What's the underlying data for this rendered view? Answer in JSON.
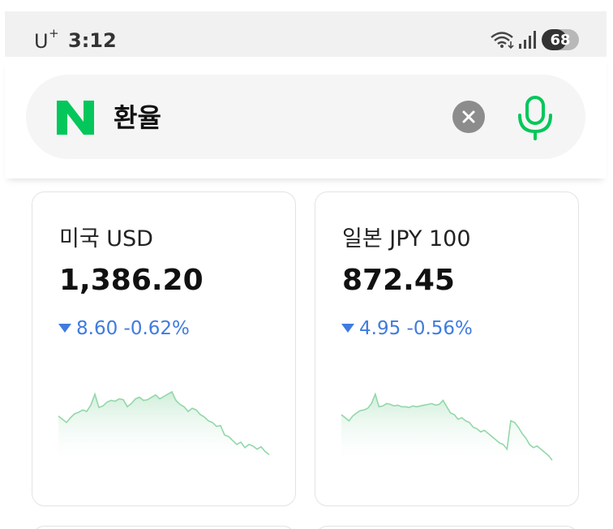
{
  "status_bar": {
    "carrier": "U",
    "carrier_mark": "+",
    "time": "3:12",
    "battery": "68",
    "battery_level": 0.68
  },
  "search": {
    "logo": "N",
    "query": "환율",
    "clear_icon": "close-icon",
    "mic_icon": "microphone-icon"
  },
  "colors": {
    "brand_green": "#03c75a",
    "down_blue": "#3f7be0",
    "chart_line": "#93d7a9"
  },
  "cards": [
    {
      "title": "미국 USD",
      "rate": "1,386.20",
      "change": "8.60",
      "change_pct": "-0.62%",
      "direction": "down",
      "sparkline": [
        68,
        72,
        76,
        70,
        65,
        63,
        60,
        62,
        54,
        40,
        57,
        55,
        50,
        48,
        49,
        46,
        47,
        56,
        52,
        46,
        44,
        48,
        47,
        44,
        41,
        46,
        43,
        40,
        37,
        48,
        53,
        56,
        62,
        58,
        60,
        66,
        69,
        74,
        76,
        81,
        80,
        92,
        94,
        99,
        104,
        101,
        108,
        104,
        106,
        110,
        107,
        113,
        117
      ]
    },
    {
      "title": "일본 JPY 100",
      "rate": "872.45",
      "change": "4.95",
      "change_pct": "-0.56%",
      "direction": "down",
      "sparkline": [
        66,
        70,
        74,
        68,
        64,
        61,
        60,
        58,
        52,
        40,
        56,
        55,
        52,
        53,
        55,
        54,
        56,
        56,
        57,
        55,
        56,
        55,
        54,
        53,
        52,
        54,
        53,
        48,
        56,
        64,
        66,
        72,
        70,
        74,
        76,
        82,
        84,
        88,
        86,
        90,
        94,
        98,
        102,
        104,
        110,
        74,
        76,
        82,
        90,
        96,
        104,
        108,
        106,
        110,
        114,
        118,
        124
      ]
    }
  ]
}
